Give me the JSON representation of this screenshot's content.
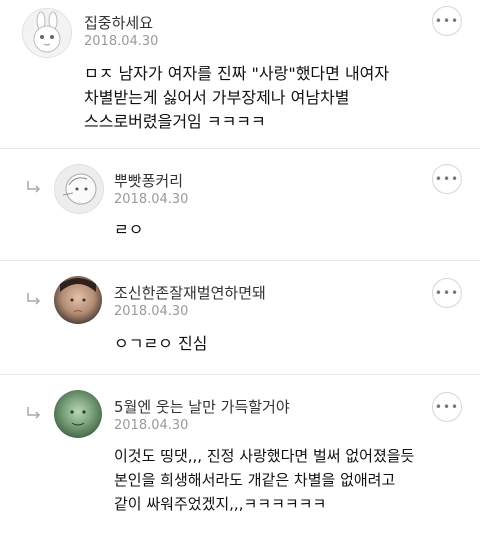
{
  "comments": [
    {
      "author": "집중하세요",
      "date": "2018.04.30",
      "text": "ㅁㅈ 남자가 여자를 진짜 \"사랑\"했다면 내여자\n차별받는게 싫어서 가부장제나 여남차별\n스스로버렸을거임 ㅋㅋㅋㅋ",
      "more": "•••"
    },
    {
      "author": "뿌빳퐁커리",
      "date": "2018.04.30",
      "text": "ㄹㅇ",
      "more": "•••"
    },
    {
      "author": "조신한존잘재벌연하면돼",
      "date": "2018.04.30",
      "text": "ㅇㄱㄹㅇ 진심",
      "more": "•••"
    },
    {
      "author": "5월엔 웃는 날만 가득할거야",
      "date": "2018.04.30",
      "text": "이것도 띵댓,,, 진정 사랑했다면 벌써 없어졌을듯\n본인을 희생해서라도 개같은 차별을 없애려고\n같이 싸워주었겠지,,,ㅋㅋㅋㅋㅋㅋ",
      "more": "•••"
    }
  ]
}
